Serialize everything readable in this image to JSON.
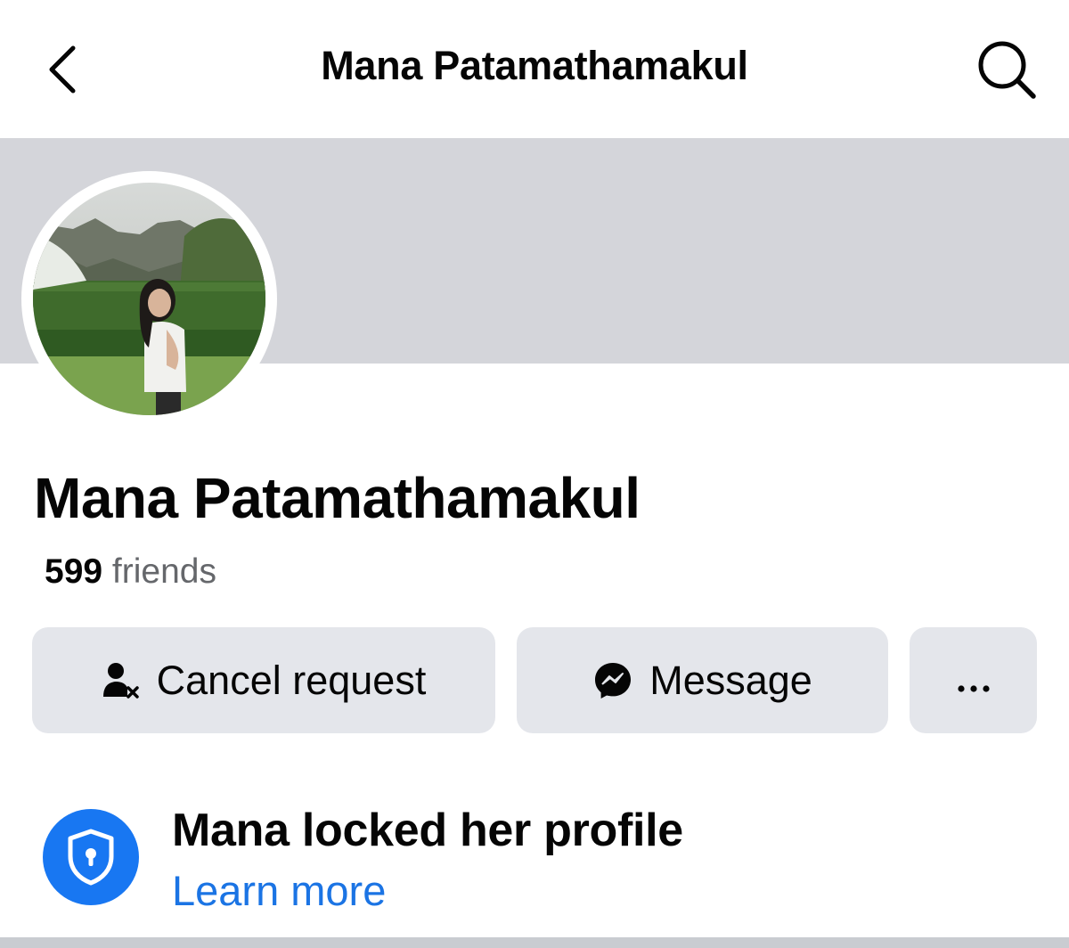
{
  "header": {
    "title": "Mana Patamathamakul",
    "back_icon": "chevron-left-icon",
    "search_icon": "search-icon"
  },
  "profile": {
    "name": "Mana Patamathamakul",
    "friends_count": "599",
    "friends_label": "friends"
  },
  "actions": {
    "cancel_request_label": "Cancel request",
    "cancel_request_icon": "person-cancel-icon",
    "message_label": "Message",
    "message_icon": "messenger-icon",
    "more_label": "···",
    "more_icon": "more-dots-icon"
  },
  "lock_notice": {
    "title": "Mana locked her profile",
    "link": "Learn more",
    "icon": "shield-lock-icon"
  },
  "colors": {
    "accent": "#1877f2",
    "link": "#1b74e4",
    "cover": "#d4d5da",
    "button_bg": "#e4e6eb",
    "secondary_text": "#65676b"
  }
}
